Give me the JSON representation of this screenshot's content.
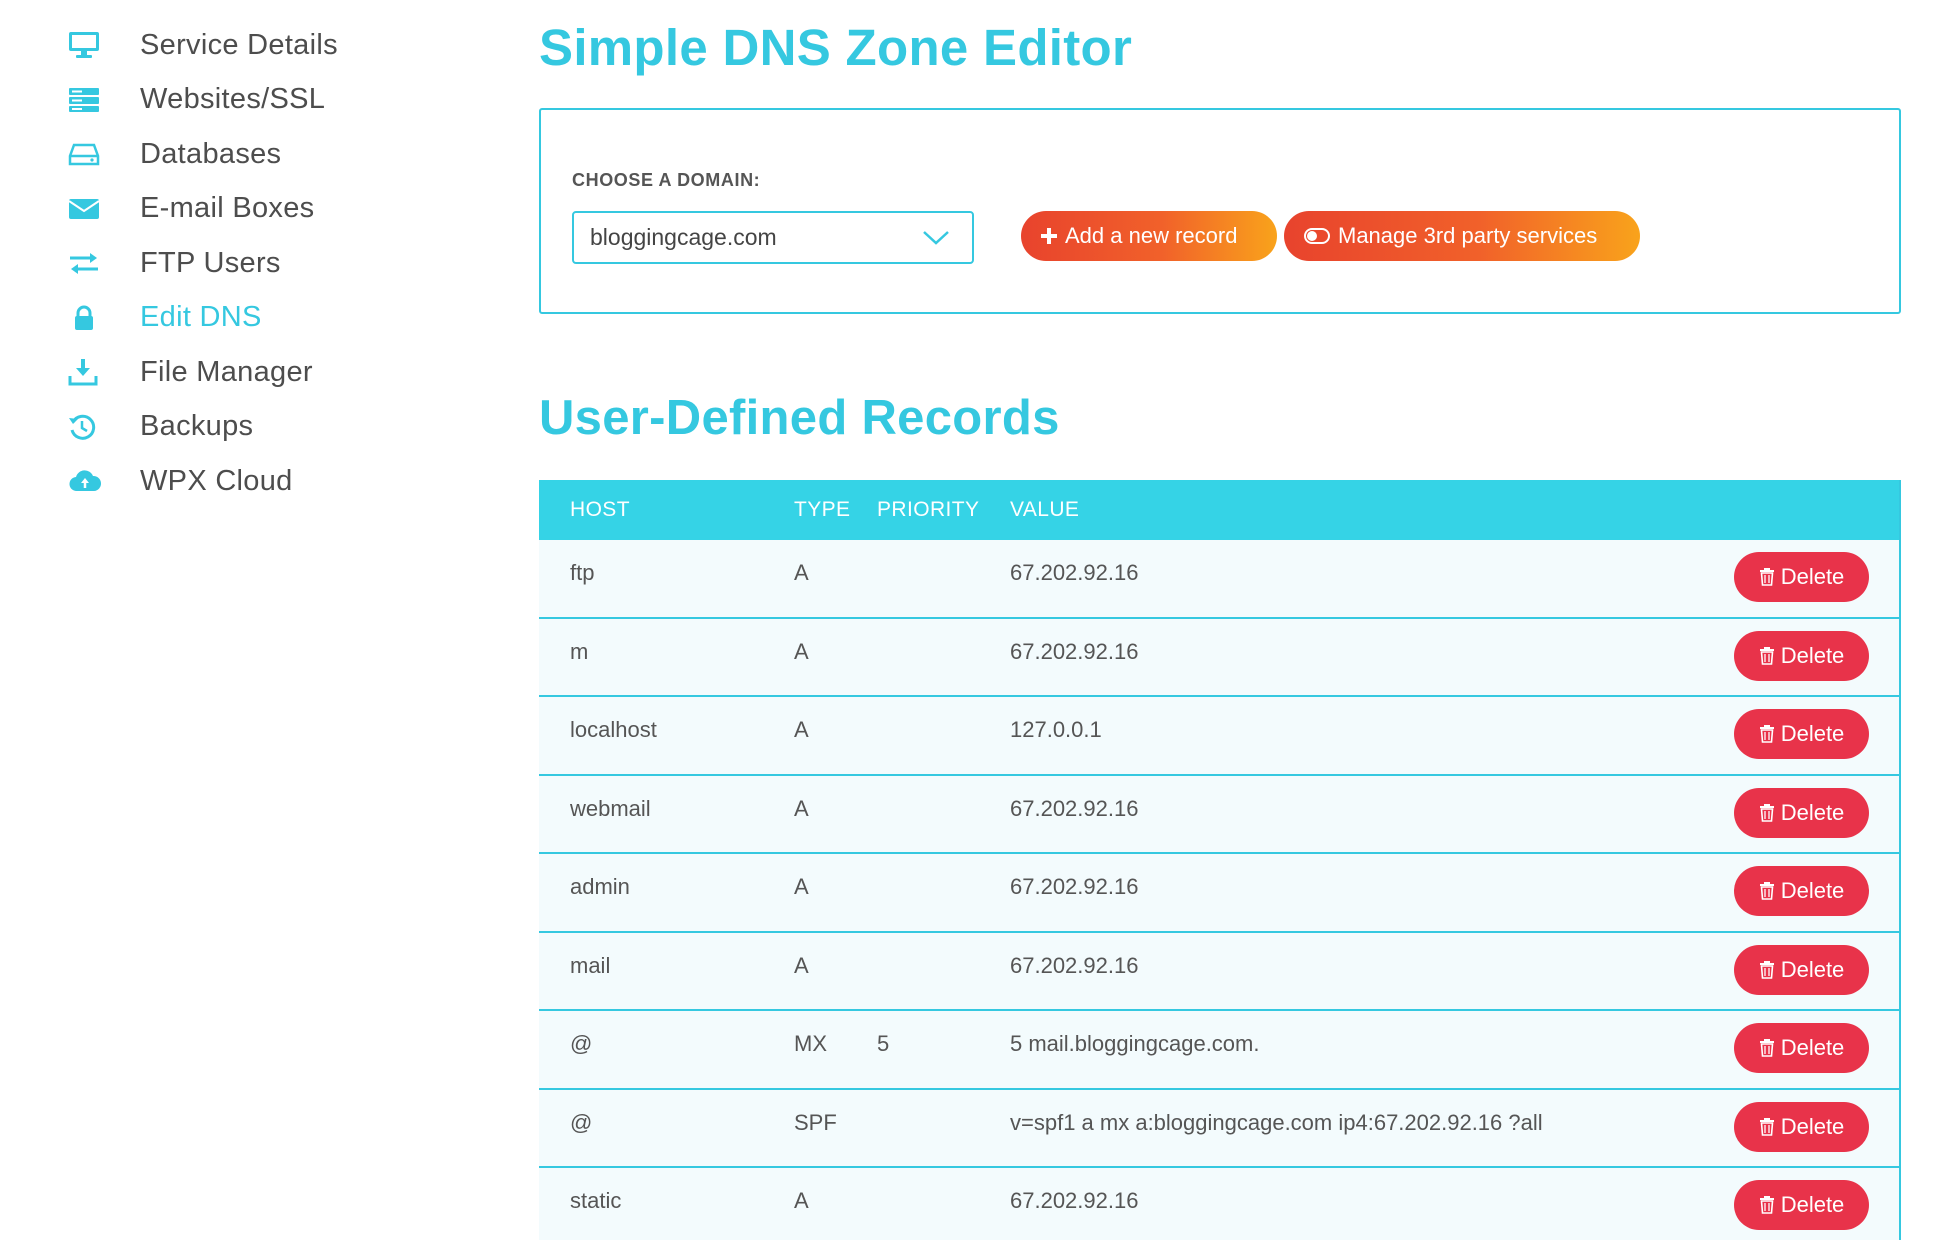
{
  "sidebar": {
    "items": [
      {
        "label": "Service Details",
        "icon": "monitor-icon",
        "active": false
      },
      {
        "label": "Websites/SSL",
        "icon": "server-icon",
        "active": false
      },
      {
        "label": "Databases",
        "icon": "hard-drive-icon",
        "active": false
      },
      {
        "label": "E-mail Boxes",
        "icon": "envelope-icon",
        "active": false
      },
      {
        "label": "FTP Users",
        "icon": "transfer-arrows-icon",
        "active": false
      },
      {
        "label": "Edit DNS",
        "icon": "lock-icon",
        "active": true
      },
      {
        "label": "File Manager",
        "icon": "download-icon",
        "active": false
      },
      {
        "label": "Backups",
        "icon": "history-icon",
        "active": false
      },
      {
        "label": "WPX Cloud",
        "icon": "cloud-upload-icon",
        "active": false
      }
    ]
  },
  "main": {
    "title": "Simple DNS Zone Editor",
    "domain_label": "CHOOSE A DOMAIN:",
    "domain_selected": "bloggingcage.com",
    "add_record_label": "Add a new record",
    "manage_label": "Manage 3rd party services",
    "records_title": "User-Defined Records"
  },
  "table": {
    "headers": {
      "host": "HOST",
      "type": "TYPE",
      "priority": "PRIORITY",
      "value": "VALUE"
    },
    "delete_label": "Delete",
    "rows": [
      {
        "host": "ftp",
        "type": "A",
        "priority": "",
        "value": "67.202.92.16"
      },
      {
        "host": "m",
        "type": "A",
        "priority": "",
        "value": "67.202.92.16"
      },
      {
        "host": "localhost",
        "type": "A",
        "priority": "",
        "value": "127.0.0.1"
      },
      {
        "host": "webmail",
        "type": "A",
        "priority": "",
        "value": "67.202.92.16"
      },
      {
        "host": "admin",
        "type": "A",
        "priority": "",
        "value": "67.202.92.16"
      },
      {
        "host": "mail",
        "type": "A",
        "priority": "",
        "value": "67.202.92.16"
      },
      {
        "host": "@",
        "type": "MX",
        "priority": "5",
        "value": "5 mail.bloggingcage.com."
      },
      {
        "host": "@",
        "type": "SPF",
        "priority": "",
        "value": "v=spf1 a mx a:bloggingcage.com ip4:67.202.92.16 ?all"
      },
      {
        "host": "static",
        "type": "A",
        "priority": "",
        "value": "67.202.92.16"
      }
    ]
  },
  "colors": {
    "accent": "#35c8e0",
    "header_bg": "#35d3e6",
    "delete": "#e8334a",
    "gradient_start": "#e8432d",
    "gradient_end": "#f9a31b"
  }
}
